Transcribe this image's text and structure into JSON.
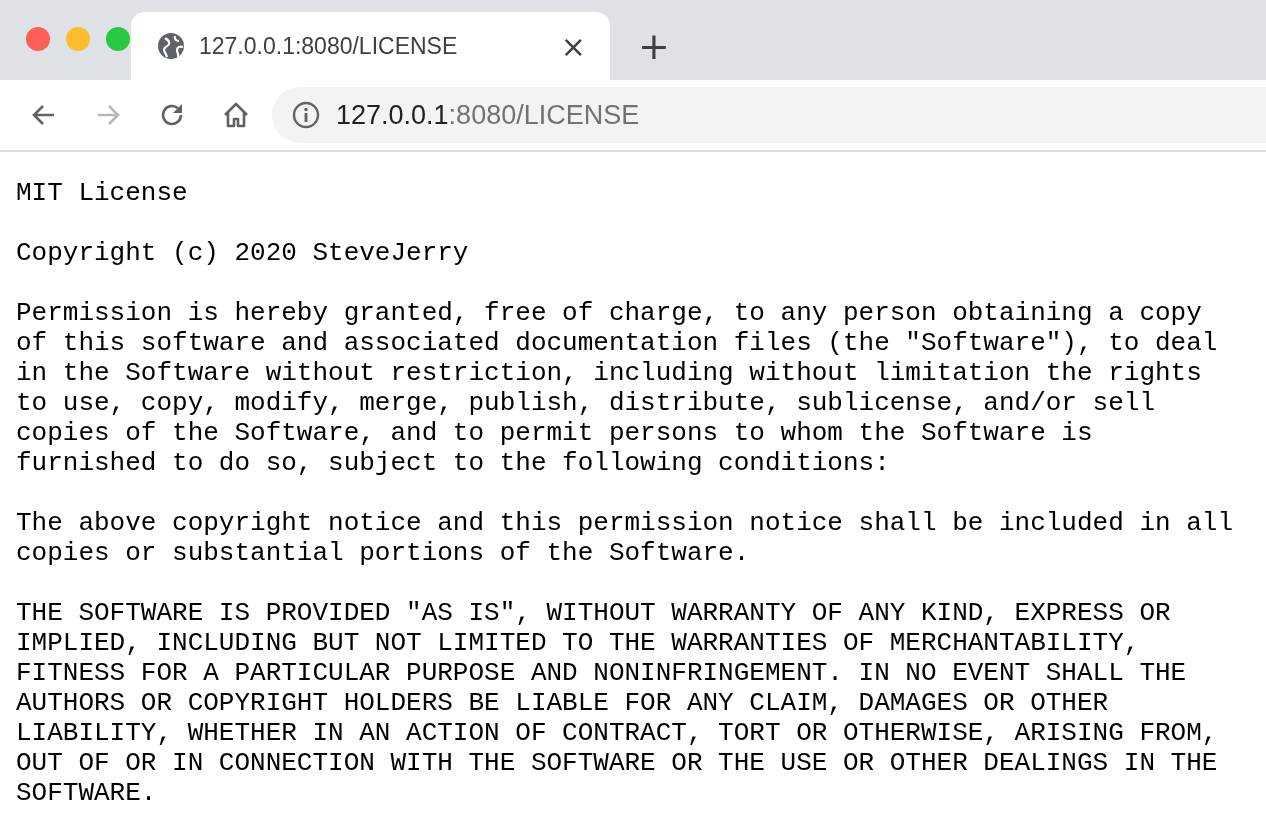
{
  "tabs": [
    {
      "title": "127.0.0.1:8080/LICENSE",
      "close": "×",
      "selected": true
    }
  ],
  "new_tab": "+",
  "nav": [
    {
      "kind": "back",
      "disabled": false
    },
    {
      "kind": "forward",
      "disabled": true
    },
    {
      "kind": "reload",
      "disabled": false
    },
    {
      "kind": "home",
      "disabled": false
    }
  ],
  "address_bar": {
    "host": "127.0.0.1",
    "path": ":8080/LICENSE"
  },
  "content": {
    "paragraphs": [
      "MIT License",
      "Copyright (c) 2020 SteveJerry",
      "Permission is hereby granted, free of charge, to any person obtaining a copy\nof this software and associated documentation files (the \"Software\"), to deal\nin the Software without restriction, including without limitation the rights\nto use, copy, modify, merge, publish, distribute, sublicense, and/or sell\ncopies of the Software, and to permit persons to whom the Software is\nfurnished to do so, subject to the following conditions:",
      "The above copyright notice and this permission notice shall be included in all\ncopies or substantial portions of the Software.",
      "THE SOFTWARE IS PROVIDED \"AS IS\", WITHOUT WARRANTY OF ANY KIND, EXPRESS OR\nIMPLIED, INCLUDING BUT NOT LIMITED TO THE WARRANTIES OF MERCHANTABILITY,\nFITNESS FOR A PARTICULAR PURPOSE AND NONINFRINGEMENT. IN NO EVENT SHALL THE\nAUTHORS OR COPYRIGHT HOLDERS BE LIABLE FOR ANY CLAIM, DAMAGES OR OTHER\nLIABILITY, WHETHER IN AN ACTION OF CONTRACT, TORT OR OTHERWISE, ARISING FROM,\nOUT OF OR IN CONNECTION WITH THE SOFTWARE OR THE USE OR OTHER DEALINGS IN THE\nSOFTWARE."
    ]
  }
}
